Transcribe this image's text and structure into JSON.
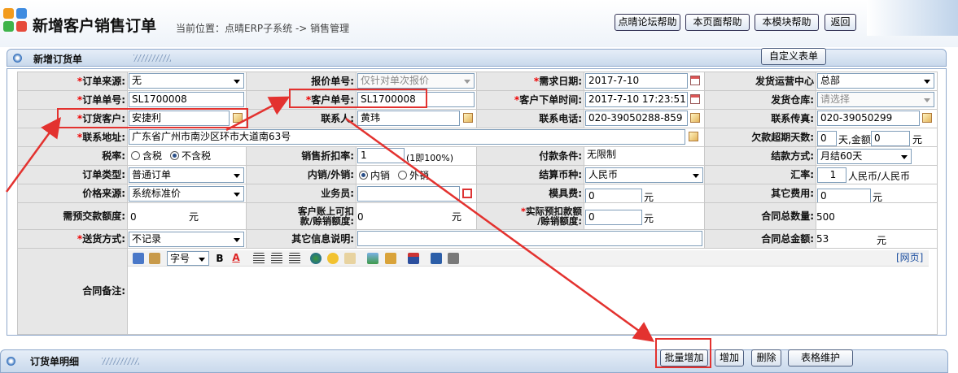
{
  "header": {
    "title": "新增客户销售订单",
    "breadcrumb": "当前位置：点晴ERP子系统 -> 销售管理",
    "buttons": [
      "点晴论坛帮助",
      "本页面帮助",
      "本模块帮助",
      "返回"
    ]
  },
  "panel": {
    "title": "新增订货单",
    "custom_button": "自定义表单"
  },
  "form": {
    "order_source": {
      "label": "订单来源:",
      "value": "无"
    },
    "quote_no": {
      "label": "报价单号:",
      "value": "仅针对单次报价"
    },
    "need_date": {
      "label": "需求日期:",
      "value": "2017-7-10"
    },
    "ship_center": {
      "label": "发货运营中心",
      "value": "总部"
    },
    "order_no": {
      "label": "订单单号:",
      "value": "SL1700008"
    },
    "cust_order_no": {
      "label": "客户单号:",
      "value": "SL1700008"
    },
    "cust_order_time": {
      "label": "客户下单时间:",
      "value": "2017-7-10 17:23:51"
    },
    "warehouse": {
      "label": "发货仓库:",
      "value": "请选择"
    },
    "customer": {
      "label": "订货客户:",
      "value": "安捷利"
    },
    "contact": {
      "label": "联系人:",
      "value": "黄玮"
    },
    "phone": {
      "label": "联系电话:",
      "value": "020-39050288-859"
    },
    "fax": {
      "label": "联系传真:",
      "value": "020-39050299"
    },
    "address": {
      "label": "联系地址:",
      "value": "广东省广州市南沙区环市大道南63号"
    },
    "overdue": {
      "label": "欠款超期天数:",
      "days": "0",
      "mid": "天,金额",
      "amount": "0",
      "unit": "元"
    },
    "tax": {
      "label": "税率:",
      "opt1": "含税",
      "opt2": "不含税"
    },
    "discount": {
      "label": "销售折扣率:",
      "value": "1",
      "note": "(1即100%)"
    },
    "pay_terms": {
      "label": "付款条件:",
      "value": "无限制"
    },
    "settle": {
      "label": "结款方式:",
      "value": "月结60天"
    },
    "order_type": {
      "label": "订单类型:",
      "value": "普通订单"
    },
    "domestic": {
      "label": "内销/外销:",
      "opt1": "内销",
      "opt2": "外销"
    },
    "currency": {
      "label": "结算币种:",
      "value": "人民币"
    },
    "rate": {
      "label": "汇率:",
      "value": "1",
      "unit": "人民币/人民币"
    },
    "price_source": {
      "label": "价格来源:",
      "value": "系统标准价"
    },
    "salesman": {
      "label": "业务员:",
      "value": ""
    },
    "mold_fee": {
      "label": "模具费:",
      "value": "0",
      "unit": "元"
    },
    "other_fee": {
      "label": "其它费用:",
      "value": "0",
      "unit": "元"
    },
    "prepay": {
      "label": "需预交款额度:",
      "value": "0",
      "unit": "元"
    },
    "cust_acct": {
      "label1": "客户账上可扣",
      "label2": "款/赊销额度:",
      "value": "0",
      "unit": "元"
    },
    "actual_prepay": {
      "label1": "实际预扣款额",
      "label2": "/赊销额度:",
      "value": "0",
      "unit": "元"
    },
    "total_qty": {
      "label": "合同总数量:",
      "value": "500"
    },
    "delivery": {
      "label": "送货方式:",
      "value": "不记录"
    },
    "other_info": {
      "label": "其它信息说明:",
      "value": ""
    },
    "total_amt": {
      "label": "合同总金额:",
      "value": "53",
      "unit": "元"
    },
    "remark": {
      "label": "合同备注:",
      "font_select": "字号",
      "webpage": "[网页]"
    }
  },
  "detail": {
    "title": "订货单明细",
    "buttons": [
      "批量增加",
      "增加",
      "删除",
      "表格维护"
    ]
  },
  "colors": {
    "annotation": "#e3322f",
    "panel_border": "#8fa9cc",
    "label_bg": "#e7e7e7"
  }
}
